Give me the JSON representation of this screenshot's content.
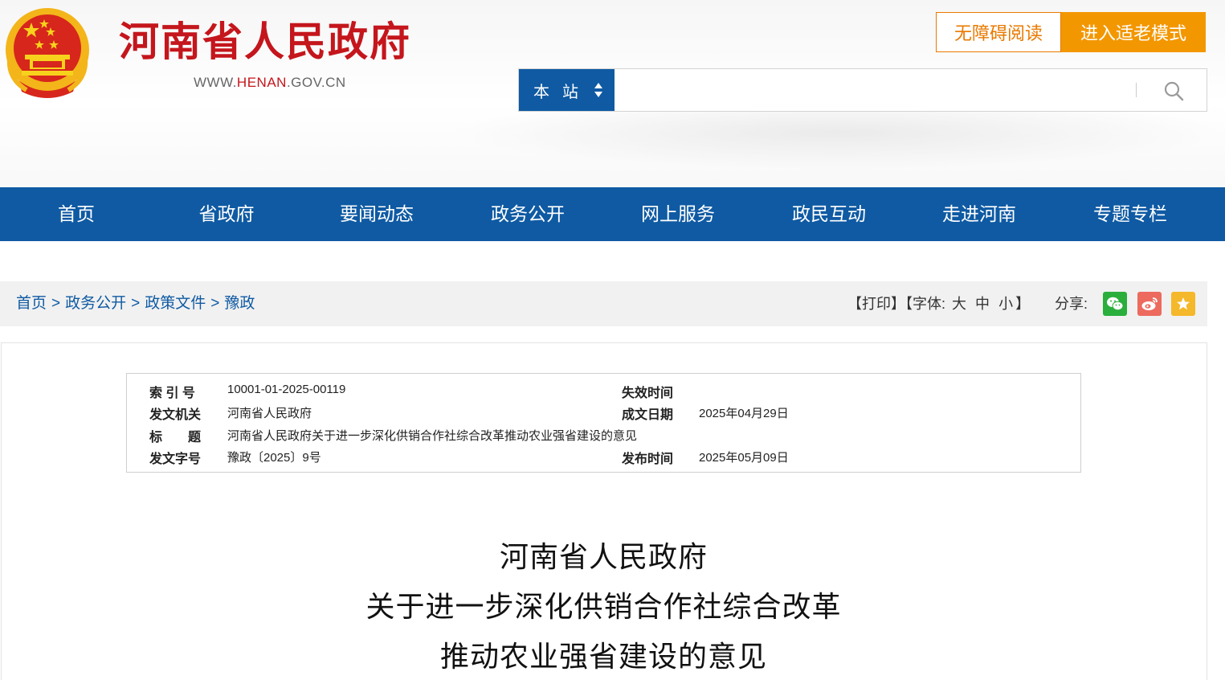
{
  "header": {
    "site_title": "河南省人民政府",
    "site_url_prefix": "WWW.",
    "site_url_domain": "HENAN",
    "site_url_suffix": ".GOV.CN",
    "accessibility_button": "无障碍阅读",
    "elder_mode_button": "进入适老模式",
    "search": {
      "scope_label": "本站",
      "placeholder": ""
    }
  },
  "nav": {
    "items": [
      "首页",
      "省政府",
      "要闻动态",
      "政务公开",
      "网上服务",
      "政民互动",
      "走进河南",
      "专题专栏"
    ]
  },
  "breadcrumb": {
    "items": [
      "首页",
      "政务公开",
      "政策文件",
      "豫政"
    ],
    "separator": ">"
  },
  "tools": {
    "print": "【打印】",
    "font_prefix": "【字体:",
    "font_large": "大",
    "font_medium": "中",
    "font_small": "小",
    "font_suffix": "】",
    "share_label": "分享:"
  },
  "meta": {
    "index_label": "索 引 号",
    "index_value": "10001-01-2025-00119",
    "expire_label": "失效时间",
    "expire_value": "",
    "issuer_label": "发文机关",
    "issuer_value": "河南省人民政府",
    "created_label": "成文日期",
    "created_value": "2025年04月29日",
    "title_label": "标　　题",
    "title_value": "河南省人民政府关于进一步深化供销合作社综合改革推动农业强省建设的意见",
    "docno_label": "发文字号",
    "docno_value": "豫政〔2025〕9号",
    "publish_label": "发布时间",
    "publish_value": "2025年05月09日"
  },
  "document": {
    "title_line1": "河南省人民政府",
    "title_line2": "关于进一步深化供销合作社综合改革",
    "title_line3": "推动农业强省建设的意见"
  },
  "colors": {
    "brand_red": "#c4161c",
    "nav_blue": "#0f5aa3",
    "orange": "#f39700"
  }
}
